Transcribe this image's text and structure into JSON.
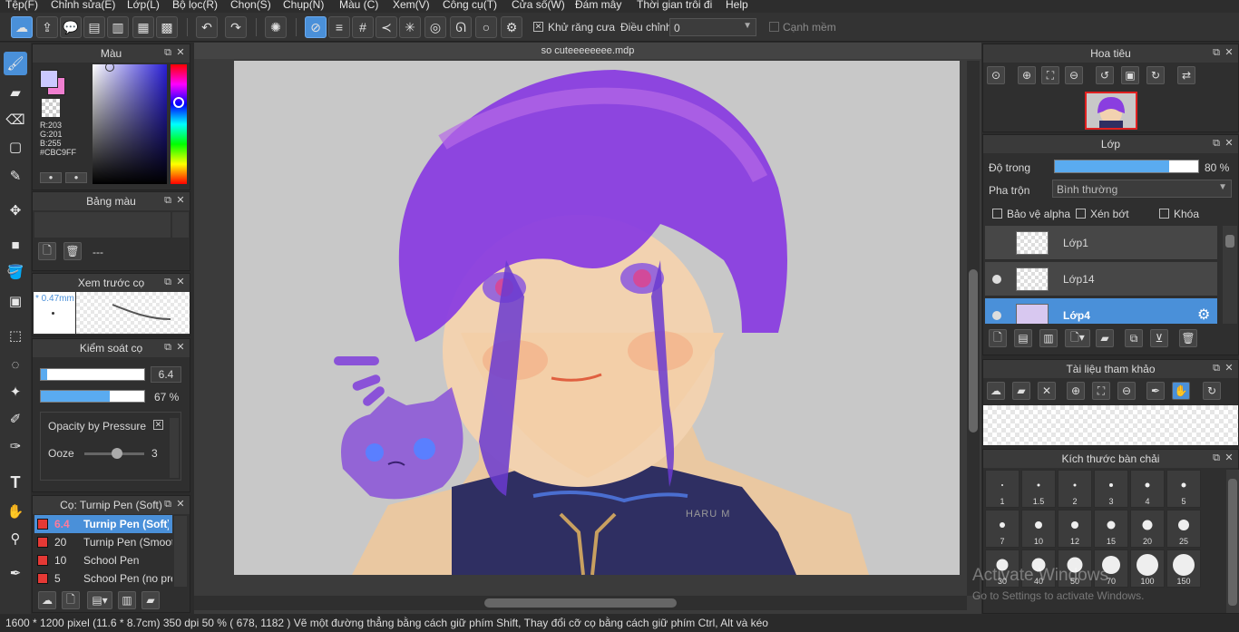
{
  "menu": [
    "Tệp(F)",
    "Chỉnh sửa(E)",
    "Lớp(L)",
    "Bộ lọc(R)",
    "Chọn(S)",
    "Chụp(N)",
    "Màu (C)",
    "Xem(V)",
    "Công cụ(T)",
    "Cửa sổ(W)",
    "Đám mây",
    "Thời gian trôi đi",
    "Help"
  ],
  "toolbar": {
    "antialias_label": "Khử răng cưa",
    "correction_label": "Điều chỉnh",
    "correction_value": "0",
    "soft_edge_label": "Cạnh mềm"
  },
  "color_panel": {
    "title": "Màu",
    "r": "R:203",
    "g": "G:201",
    "b": "B:255",
    "hex": "#CBC9FF"
  },
  "palette_panel": {
    "title": "Bảng màu",
    "name": "---"
  },
  "brush_preview": {
    "title": "Xem trước cọ",
    "size": "* 0.47mm"
  },
  "brush_control": {
    "title": "Kiểm soát cọ",
    "size_value": "6.4",
    "opacity_value": "67 %",
    "opacity_fraction": 0.67,
    "size_fraction": 0.06,
    "pressure_label": "Opacity by Pressure",
    "ooze_label": "Ooze",
    "ooze_value": "3"
  },
  "brush_list": {
    "title": "Cọ: Turnip Pen (Soft)",
    "items": [
      {
        "size": "6.4",
        "name": "Turnip Pen (Soft)"
      },
      {
        "size": "20",
        "name": "Turnip Pen (Smooth)"
      },
      {
        "size": "10",
        "name": "School Pen"
      },
      {
        "size": "5",
        "name": "School Pen (no pressure)"
      }
    ]
  },
  "document": {
    "tab": "so cuteeeeeeee.mdp",
    "signature": "HARU M"
  },
  "navigator": {
    "title": "Hoa tiêu"
  },
  "layer_panel": {
    "title": "Lớp",
    "opacity_label": "Độ trong",
    "opacity_value": "80 %",
    "opacity_fraction": 0.8,
    "blend_label": "Pha trộn",
    "blend_value": "Bình thường",
    "protect_alpha": "Bảo vệ alpha",
    "clipping": "Xén bớt",
    "lock": "Khóa",
    "layers": [
      "Lớp1",
      "Lớp14",
      "Lớp4"
    ]
  },
  "reference_panel": {
    "title": "Tài liệu tham khảo"
  },
  "brush_size_panel": {
    "title": "Kích thước bàn chải",
    "sizes": [
      "1",
      "1.5",
      "2",
      "3",
      "4",
      "5",
      "7",
      "10",
      "12",
      "15",
      "20",
      "25",
      "30",
      "40",
      "50",
      "70",
      "100",
      "150"
    ]
  },
  "status": {
    "text": "1600 * 1200 pixel   (11.6 * 8.7cm)   350 dpi   50 %   ( 678, 1182 )   Vẽ một đường thẳng bằng cách giữ phím Shift, Thay đổi cỡ cọ bằng cách giữ phím Ctrl, Alt và kéo"
  },
  "watermark": {
    "line1": "Activate Windows",
    "line2": "Go to Settings to activate Windows."
  },
  "colors": {
    "accent": "#4a90d9",
    "current_color": "#CBC9FF",
    "hair": "#8a3ee0"
  }
}
